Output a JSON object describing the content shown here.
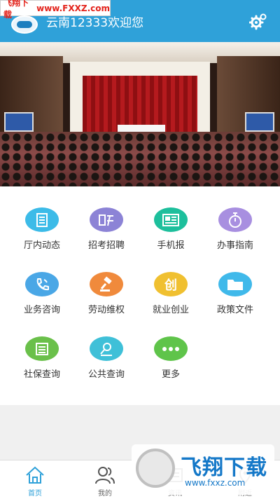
{
  "header": {
    "title": "云南12333欢迎您",
    "watermark_cn": "飞翔下载",
    "watermark_url": "www.FXXZ.com",
    "settings_icon": "gear-icon",
    "bg_color": "#2fa1d9"
  },
  "banner": {
    "dots": 4,
    "active_dot": 1
  },
  "grid": [
    {
      "label": "厅内动态",
      "icon": "document-icon",
      "color": "#3cbbe8"
    },
    {
      "label": "招考招聘",
      "icon": "hire-icon",
      "color": "#8c83d6"
    },
    {
      "label": "手机报",
      "icon": "newspaper-icon",
      "color": "#1dbf9c"
    },
    {
      "label": "办事指南",
      "icon": "stopwatch-icon",
      "color": "#a88fe0"
    },
    {
      "label": "业务咨询",
      "icon": "phone-icon",
      "color": "#4aa7e6"
    },
    {
      "label": "劳动维权",
      "icon": "gavel-icon",
      "color": "#f08a3c"
    },
    {
      "label": "就业创业",
      "icon": "create-icon",
      "color": "#f0c030"
    },
    {
      "label": "政策文件",
      "icon": "folder-icon",
      "color": "#40b9ea"
    },
    {
      "label": "社保查询",
      "icon": "list-icon",
      "color": "#6ac04a"
    },
    {
      "label": "公共查询",
      "icon": "search-person-icon",
      "color": "#3fc0d8"
    },
    {
      "label": "更多",
      "icon": "more-icon",
      "color": "#5fc44a"
    }
  ],
  "grid_glyphs": {
    "create": "创"
  },
  "bottom_nav": [
    {
      "label": "首页",
      "icon": "home-icon",
      "active": true
    },
    {
      "label": "我的",
      "icon": "users-icon",
      "active": false
    },
    {
      "label": "资讯",
      "icon": "news-icon",
      "active": false
    },
    {
      "label": "附近",
      "icon": "location-icon",
      "active": false
    }
  ],
  "watermark_bottom": {
    "title": "飞翔下载",
    "url": "www.fxxz.com"
  },
  "accent_color": "#2fa1d9"
}
